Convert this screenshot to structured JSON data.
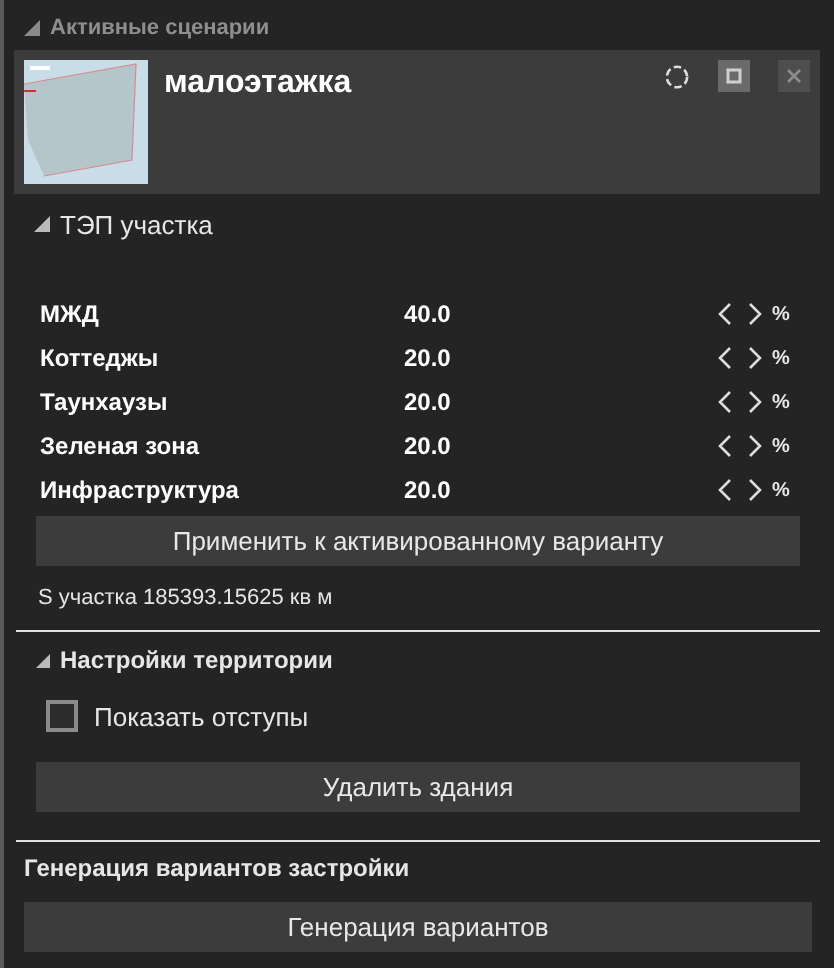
{
  "panel_title": "Активные сценарии",
  "scenario": {
    "title": "малоэтажка"
  },
  "tep_section": {
    "title": "ТЭП участка",
    "expanded": true,
    "rows": [
      {
        "label": "МЖД",
        "value": "40.0",
        "unit": "%"
      },
      {
        "label": "Коттеджы",
        "value": "20.0",
        "unit": "%"
      },
      {
        "label": "Таунхаузы",
        "value": "20.0",
        "unit": "%"
      },
      {
        "label": "Зеленая зона",
        "value": "20.0",
        "unit": "%"
      },
      {
        "label": "Инфраструктура",
        "value": "20.0",
        "unit": "%"
      }
    ],
    "apply_button": "Применить к активированному варианту",
    "area_text": "S участка 185393.15625 кв м"
  },
  "territory_section": {
    "title": "Настройки территории",
    "expanded": true,
    "checkbox": {
      "label": "Показать отступы",
      "checked": false
    },
    "delete_button": "Удалить здания"
  },
  "generation_section": {
    "title": "Генерация вариантов застройки",
    "button": "Генерация вариантов"
  }
}
